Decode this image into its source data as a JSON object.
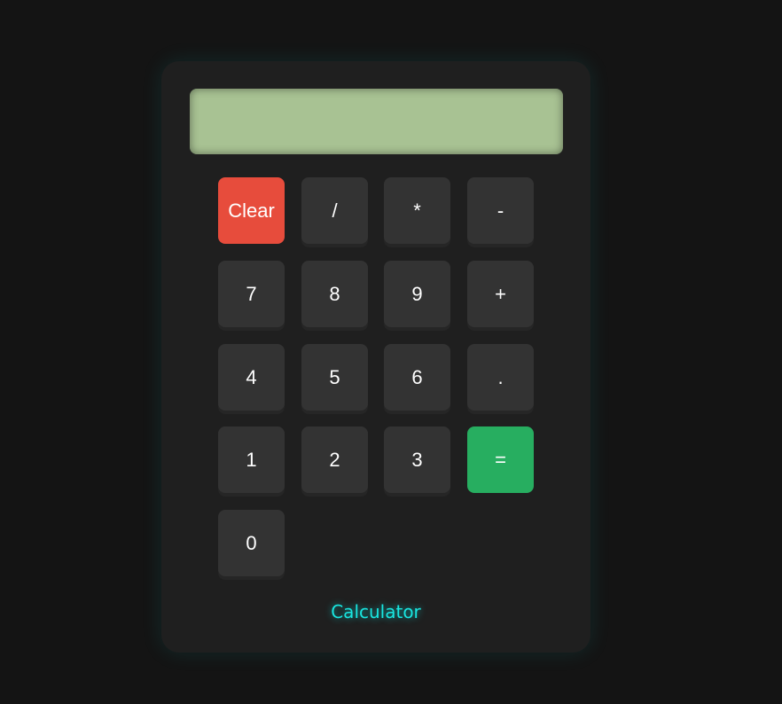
{
  "display": {
    "value": ""
  },
  "keys": {
    "clear": "Clear",
    "divide": "/",
    "multiply": "*",
    "subtract": "-",
    "seven": "7",
    "eight": "8",
    "nine": "9",
    "add": "+",
    "four": "4",
    "five": "5",
    "six": "6",
    "decimal": ".",
    "one": "1",
    "two": "2",
    "three": "3",
    "equals": "=",
    "zero": "0"
  },
  "footer": {
    "label": "Calculator"
  },
  "colors": {
    "background": "#141414",
    "panel": "#1f1f1f",
    "display": "#a8c293",
    "key": "#333333",
    "clear_key": "#e74c3c",
    "equals_key": "#27ae60",
    "accent_text": "#19e6e0"
  }
}
